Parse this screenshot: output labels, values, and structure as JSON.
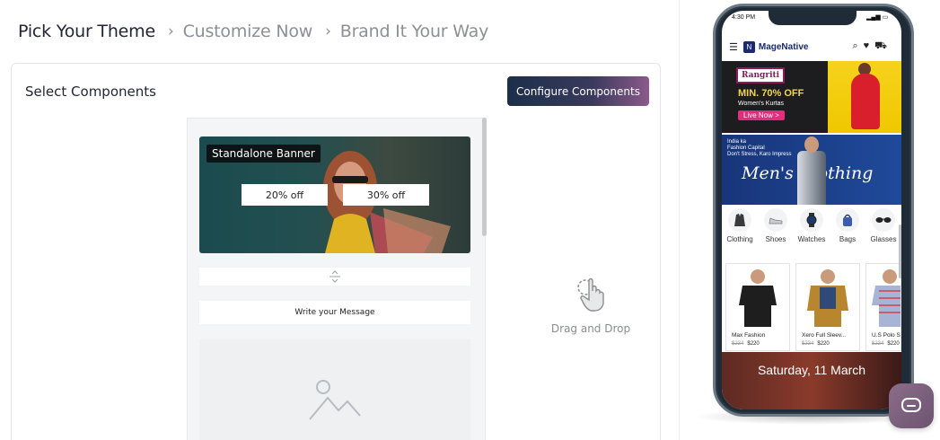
{
  "breadcrumb": {
    "step1": "Pick Your Theme",
    "step2": "Customize Now",
    "step3": "Brand It Your Way"
  },
  "panel": {
    "title": "Select Components",
    "configure_button": "Configure Components"
  },
  "builder": {
    "banner_tag": "Standalone Banner",
    "offer1": "20% off",
    "offer2": "30% off",
    "message_placeholder": "Write your Message"
  },
  "drag_drop": {
    "label": "Drag and Drop"
  },
  "phone": {
    "status_time": "4:30 PM",
    "brand": "MageNative",
    "promo1": {
      "logo": "Rangriti",
      "offer": "MIN. 70% OFF",
      "subtitle": "Women's Kurtas",
      "cta": "Live Now >"
    },
    "promo2": {
      "caption_line1": "India ka",
      "caption_line2": "Fashion Capital",
      "caption_line3": "Don't Stress, Karo Impress",
      "headline": "Men's Clothing"
    },
    "categories": [
      {
        "label": "Clothing",
        "icon": "jacket-icon"
      },
      {
        "label": "Shoes",
        "icon": "shoe-icon"
      },
      {
        "label": "Watches",
        "icon": "watch-icon"
      },
      {
        "label": "Bags",
        "icon": "bag-icon"
      },
      {
        "label": "Glasses",
        "icon": "glasses-icon"
      }
    ],
    "products": [
      {
        "name": "Max Fashion",
        "old_price": "$234",
        "price": "$220"
      },
      {
        "name": "Xero Full Sleev...",
        "old_price": "$234",
        "price": "$220"
      },
      {
        "name": "U.S Polo S",
        "old_price": "$234",
        "price": "$220"
      }
    ],
    "date_banner": "Saturday, 11 March"
  },
  "colors": {
    "button_gradient_start": "#1b2f4a",
    "button_gradient_end": "#8b5a8a",
    "chat_button": "#7a5f7c"
  }
}
